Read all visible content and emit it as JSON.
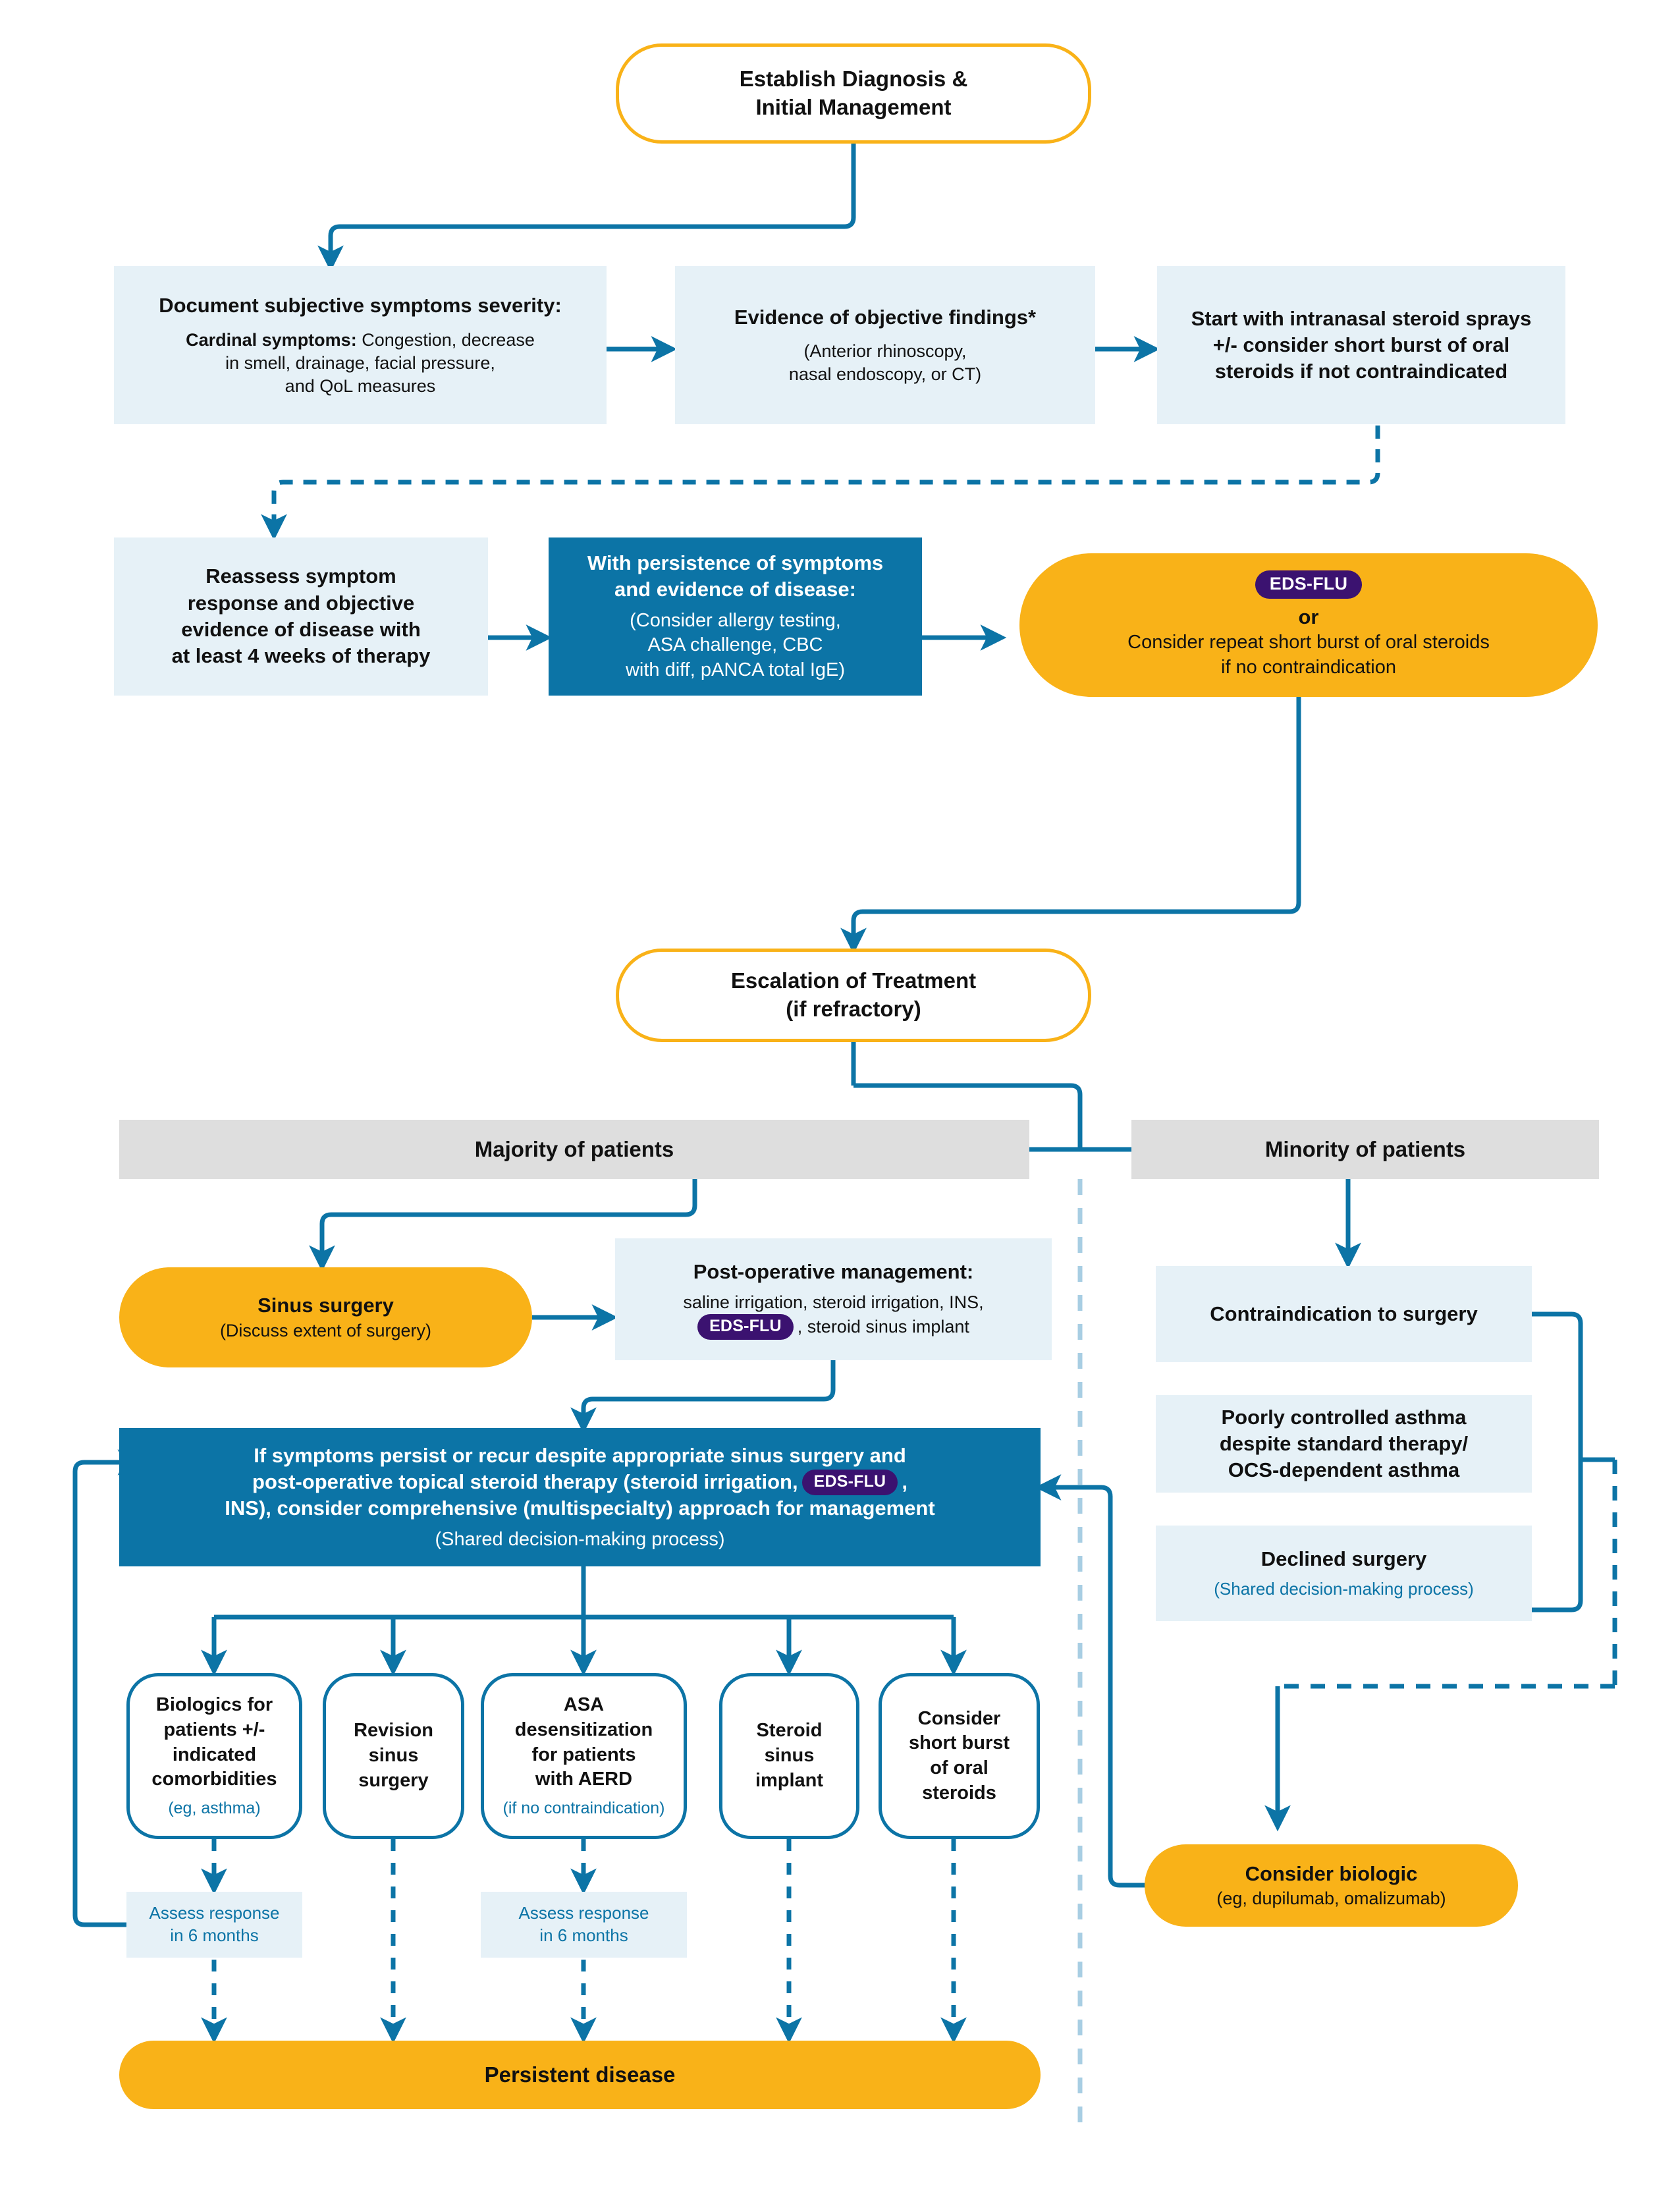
{
  "colors": {
    "orange": "#F9B218",
    "teal": "#0C74A6",
    "light_blue_fill": "#E6F1F7",
    "grey_fill": "#DEDEDE",
    "purple_pill": "#3B1270",
    "dashed_light": "#A8CEE3"
  },
  "nodes": {
    "start": {
      "line1": "Establish Diagnosis &",
      "line2": "Initial Management"
    },
    "document_symptoms": {
      "heading": "Document subjective symptoms severity:",
      "label_bold": "Cardinal symptoms:",
      "body1": " Congestion, decrease",
      "body2": "in smell, drainage, facial pressure,",
      "body3": "and QoL measures"
    },
    "objective_findings": {
      "heading": "Evidence of objective findings*",
      "body1": "(Anterior rhinoscopy,",
      "body2": "nasal endoscopy, or CT)"
    },
    "intranasal_steroids": {
      "line1": "Start with intranasal steroid sprays",
      "line2": "+/- consider short burst of oral",
      "line3": "steroids if not contraindicated"
    },
    "reassess": {
      "line1": "Reassess symptom",
      "line2": "response and objective",
      "line3": "evidence of disease with",
      "line4": "at least 4 weeks of therapy"
    },
    "persistence": {
      "heading1": "With persistence of symptoms",
      "heading2": "and evidence of disease:",
      "body1": "(Consider allergy testing,",
      "body2": "ASA challenge, CBC",
      "body3": "with diff, pANCA total IgE)"
    },
    "eds_flu_or_steroids": {
      "pill": "EDS-FLU",
      "or": "or",
      "line1": "Consider repeat short burst of oral steroids",
      "line2": "if no contraindication"
    },
    "escalation": {
      "line1": "Escalation of Treatment",
      "line2": "(if refractory)"
    },
    "majority_header": "Majority of patients",
    "minority_header": "Minority of patients",
    "sinus_surgery": {
      "heading": "Sinus surgery",
      "sub": "(Discuss extent of surgery)"
    },
    "post_op": {
      "heading": "Post-operative management:",
      "body1": "saline irrigation, steroid irrigation, INS,",
      "pill": "EDS-FLU",
      "body2": ", steroid sinus implant"
    },
    "multispecialty": {
      "line1": "If symptoms persist or recur despite appropriate sinus surgery and",
      "line2a": "post-operative topical steroid therapy (steroid irrigation,",
      "pill": "EDS-FLU",
      "line2b": ",",
      "line3": "INS), consider comprehensive (multispecialty) approach for management",
      "line4": "(Shared decision-making process)"
    },
    "options": [
      {
        "name": "biologics",
        "lines": [
          "Biologics for",
          "patients +/-",
          "indicated",
          "comorbidities"
        ],
        "sub": "(eg, asthma)"
      },
      {
        "name": "revision-surgery",
        "lines": [
          "Revision",
          "sinus",
          "surgery"
        ],
        "sub": ""
      },
      {
        "name": "asa-desensitization",
        "lines": [
          "ASA",
          "desensitization",
          "for patients",
          "with AERD"
        ],
        "sub": "(if no contraindication)"
      },
      {
        "name": "steroid-sinus-implant",
        "lines": [
          "Steroid",
          "sinus",
          "implant"
        ],
        "sub": ""
      },
      {
        "name": "short-burst-oral-steroids",
        "lines": [
          "Consider",
          "short burst",
          "of oral",
          "steroids"
        ],
        "sub": ""
      }
    ],
    "assess_response": {
      "line1": "Assess response",
      "line2": "in 6 months"
    },
    "persistent_disease": "Persistent disease",
    "contraindication": "Contraindication to surgery",
    "poorly_controlled_asthma": {
      "line1": "Poorly controlled asthma",
      "line2": "despite standard therapy/",
      "line3": "OCS-dependent asthma"
    },
    "declined_surgery": {
      "heading": "Declined surgery",
      "sub": "(Shared decision-making process)"
    },
    "consider_biologic": {
      "heading": "Consider biologic",
      "sub": "(eg, dupilumab, omalizumab)"
    }
  }
}
